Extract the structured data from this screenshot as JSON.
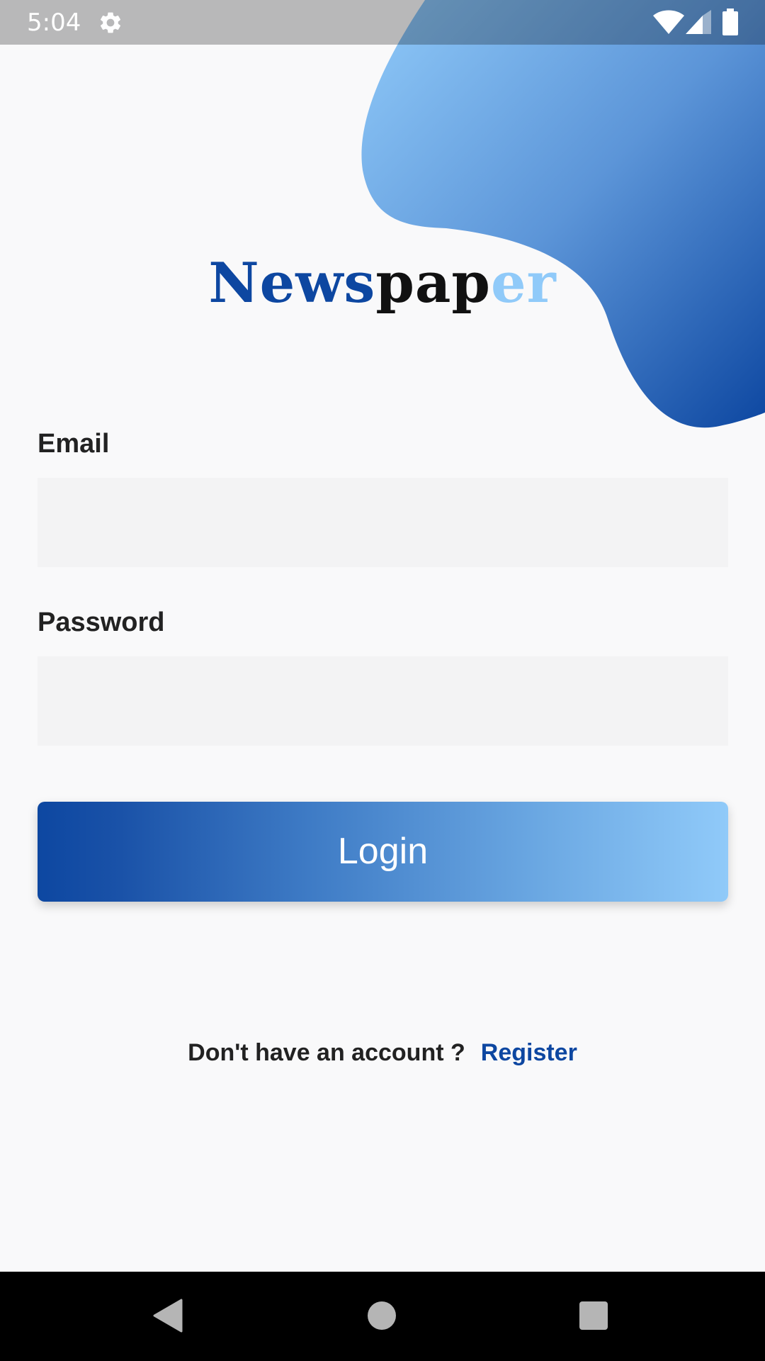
{
  "status_bar": {
    "time": "5:04",
    "icons": [
      "settings-icon",
      "wifi-icon",
      "cellular-signal-icon",
      "battery-icon"
    ]
  },
  "logo": {
    "part1": "News",
    "part2": "pap",
    "part3": "er"
  },
  "form": {
    "email_label": "Email",
    "email_value": "",
    "email_placeholder": "",
    "password_label": "Password",
    "password_value": "",
    "password_placeholder": "",
    "login_label": "Login"
  },
  "footer": {
    "prompt": "Don't have an account ?",
    "register_label": "Register"
  },
  "nav_bar": {
    "icons": [
      "back-icon",
      "home-icon",
      "recents-icon"
    ]
  },
  "colors": {
    "brand_dark": "#0d47a1",
    "brand_light": "#90caf9",
    "background": "#f9f9fa",
    "field_background": "#f3f3f4"
  }
}
